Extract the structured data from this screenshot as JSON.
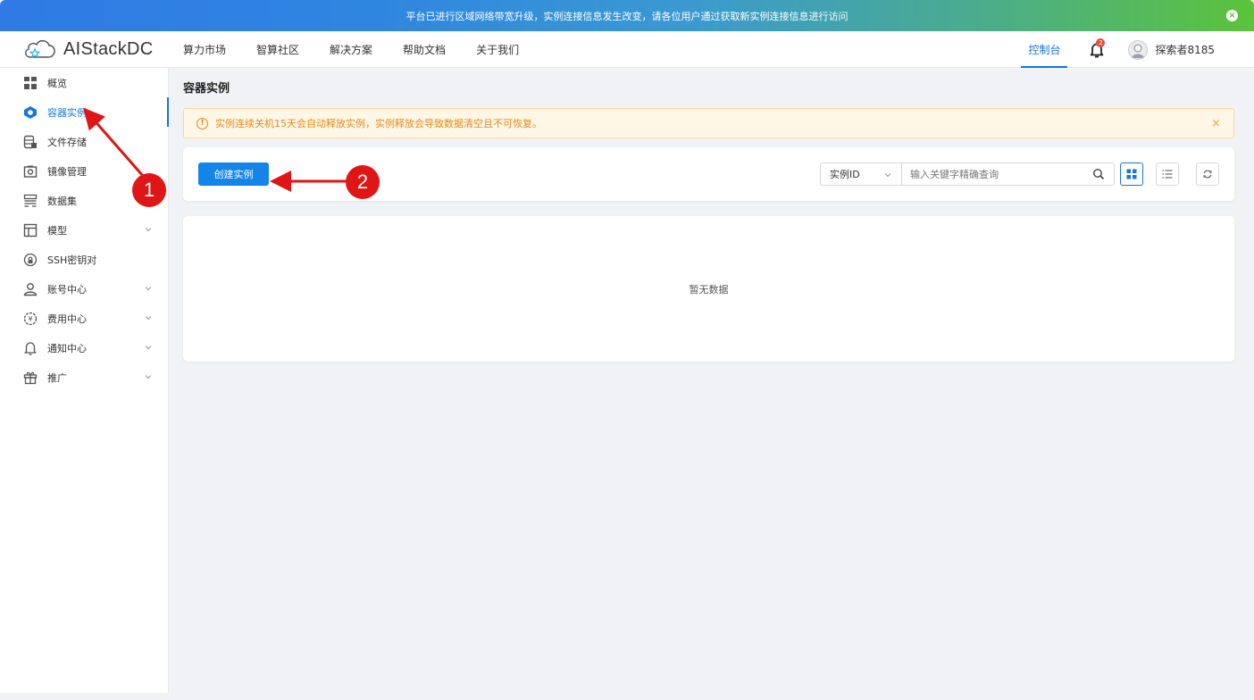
{
  "banner": {
    "message": "平台已进行区域网络带宽升级，实例连接信息发生改变，请各位用户通过获取新实例连接信息进行访问",
    "close_icon": "close-circle-icon"
  },
  "header": {
    "logo_text": "AIStackDC",
    "logo_icon": "cloud-star-icon",
    "nav": [
      "算力市场",
      "智算社区",
      "解决方案",
      "帮助文档",
      "关于我们"
    ],
    "console_label": "控制台",
    "notification_count": "2",
    "username": "探索者8185"
  },
  "sidebar": {
    "items": [
      {
        "label": "概览",
        "icon": "grid-icon",
        "expandable": false
      },
      {
        "label": "容器实例",
        "icon": "container-icon",
        "expandable": false,
        "active": true
      },
      {
        "label": "文件存储",
        "icon": "storage-icon",
        "expandable": false
      },
      {
        "label": "镜像管理",
        "icon": "camera-icon",
        "expandable": false
      },
      {
        "label": "数据集",
        "icon": "dataset-icon",
        "expandable": false
      },
      {
        "label": "模型",
        "icon": "model-icon",
        "expandable": true
      },
      {
        "label": "SSH密钥对",
        "icon": "key-icon",
        "expandable": false
      },
      {
        "label": "账号中心",
        "icon": "user-icon",
        "expandable": true
      },
      {
        "label": "费用中心",
        "icon": "yen-icon",
        "expandable": true
      },
      {
        "label": "通知中心",
        "icon": "bell-icon",
        "expandable": true
      },
      {
        "label": "推广",
        "icon": "gift-icon",
        "expandable": true
      }
    ]
  },
  "main": {
    "title": "容器实例",
    "alert": "实例连续关机15天会自动释放实例，实例释放会导致数据清空且不可恢复。",
    "create_button": "创建实例",
    "search_field_select": "实例ID",
    "search_placeholder": "输入关键字精确查询",
    "empty_text": "暂无数据"
  },
  "annotations": {
    "marker_1": "1",
    "marker_2": "2",
    "color": "#e01515"
  },
  "colors": {
    "primary": "#1677d8",
    "warning": "#e08a1e",
    "annotation": "#e01515"
  }
}
